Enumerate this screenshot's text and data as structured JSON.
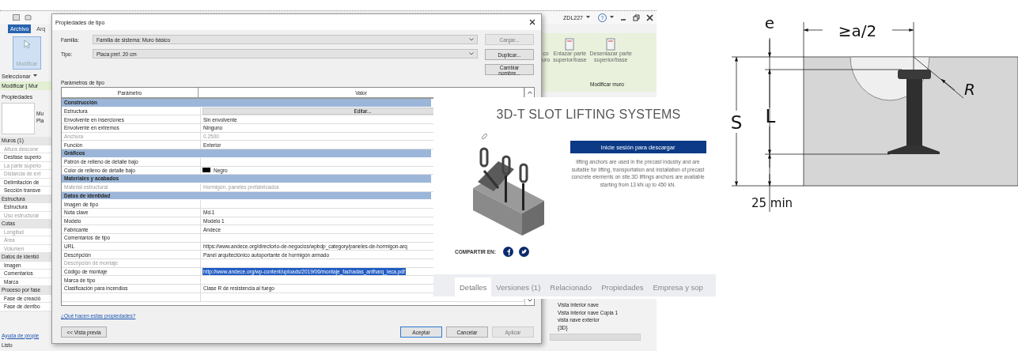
{
  "revit": {
    "user": "ZDL227",
    "help": "?",
    "tabs": [
      {
        "label": "Archivo",
        "selected": true
      },
      {
        "label": "Arq",
        "selected": false
      }
    ],
    "modify_tool": "Modificar",
    "select_menu": "Seleccionar",
    "context_bar": "Modificar | Mur",
    "properties": {
      "title": "Propiedades",
      "type_fragments": [
        "Mu",
        "Pla"
      ],
      "rows": [
        {
          "label": "Muros (1)",
          "kind": "header",
          "disabled": false
        },
        {
          "label": "Altura descone",
          "kind": "item",
          "disabled": true
        },
        {
          "label": "Desfase superio",
          "kind": "item",
          "disabled": false
        },
        {
          "label": "La parte superio",
          "kind": "item",
          "disabled": true
        },
        {
          "label": "Distancia de ext",
          "kind": "item",
          "disabled": true
        },
        {
          "label": "Delimitación de",
          "kind": "item",
          "disabled": false
        },
        {
          "label": "Sección transve",
          "kind": "item",
          "disabled": false
        },
        {
          "label": "Estructura",
          "kind": "header",
          "disabled": false
        },
        {
          "label": "Estructura",
          "kind": "item",
          "disabled": false
        },
        {
          "label": "Uso estructural",
          "kind": "item",
          "disabled": true
        },
        {
          "label": "Cotas",
          "kind": "header",
          "disabled": false
        },
        {
          "label": "Longitud",
          "kind": "item",
          "disabled": true
        },
        {
          "label": "Área",
          "kind": "item",
          "disabled": true
        },
        {
          "label": "Volumen",
          "kind": "item",
          "disabled": true
        },
        {
          "label": "Datos de identid",
          "kind": "header",
          "disabled": false
        },
        {
          "label": "Imagen",
          "kind": "item",
          "disabled": false
        },
        {
          "label": "Comentarios",
          "kind": "item",
          "disabled": false
        },
        {
          "label": "Marca",
          "kind": "item",
          "disabled": false
        },
        {
          "label": "Proceso por fase",
          "kind": "header",
          "disabled": false
        },
        {
          "label": "Fase de creació",
          "kind": "item",
          "disabled": false
        },
        {
          "label": "Fase de derribo",
          "kind": "item",
          "disabled": false
        }
      ],
      "help_link": "Ayuda de propie"
    },
    "ribbon_tools": [
      {
        "lines": [
          "co",
          "uro"
        ]
      },
      {
        "lines": [
          "Enlazar parte",
          "superior/base"
        ]
      },
      {
        "lines": [
          "Desenlazar parte",
          "superior/base"
        ]
      }
    ],
    "ribbon_panel": "Modificar muro",
    "browser_items": [
      "Vista interior nave",
      "Vista interior nave Copia 1",
      "vista nave exterior",
      "{3D}"
    ],
    "status": "Listo"
  },
  "dialog": {
    "title": "Propiedades de tipo",
    "family": {
      "label": "Familia:",
      "value": "Familia de sistema: Muro básico"
    },
    "type": {
      "label": "Tipo:",
      "value": "Placa pref. 20 cm"
    },
    "buttons": [
      {
        "label": "Cargar...",
        "disabled": true
      },
      {
        "label": "Duplicar...",
        "disabled": false
      },
      {
        "label": "Cambiar nombre...",
        "disabled": false
      }
    ],
    "section": "Parámetros de tipo",
    "columns": [
      "Parámetro",
      "Valor"
    ],
    "rows": [
      {
        "kind": "category",
        "label": "Construcción"
      },
      {
        "kind": "button",
        "label": "Estructura",
        "value": "Editar...",
        "disabled": false
      },
      {
        "kind": "text",
        "label": "Envolvente en inserciones",
        "value": "Sin envolvente",
        "disabled": false,
        "selected": false
      },
      {
        "kind": "text",
        "label": "Envolvente en extremos",
        "value": "Ninguno",
        "disabled": false,
        "selected": false
      },
      {
        "kind": "text",
        "label": "Anchura",
        "value": "0.2500",
        "disabled": true,
        "selected": false
      },
      {
        "kind": "text",
        "label": "Función",
        "value": "Exterior",
        "disabled": false,
        "selected": false
      },
      {
        "kind": "category",
        "label": "Gráficos"
      },
      {
        "kind": "text",
        "label": "Patrón de relleno de detalle bajo",
        "disabled": false
      },
      {
        "kind": "swatch",
        "label": "Color de relleno de detalle bajo",
        "value": "Negro",
        "color": "#000000",
        "disabled": false,
        "selected": false
      },
      {
        "kind": "category",
        "label": "Materiales y acabados"
      },
      {
        "kind": "text",
        "label": "Material estructural",
        "value": "Hormigón, paneles prefabricados",
        "disabled": true,
        "selected": false
      },
      {
        "kind": "category",
        "label": "Datos de identidad"
      },
      {
        "kind": "text",
        "label": "Imagen de tipo",
        "disabled": false
      },
      {
        "kind": "text",
        "label": "Nota clave",
        "value": "Md.1",
        "disabled": false,
        "selected": false
      },
      {
        "kind": "text",
        "label": "Modelo",
        "value": "Modelo 1",
        "disabled": false,
        "selected": false
      },
      {
        "kind": "text",
        "label": "Fabricante",
        "value": "Andece",
        "disabled": false,
        "selected": false
      },
      {
        "kind": "text",
        "label": "Comentarios de tipo",
        "disabled": false
      },
      {
        "kind": "text",
        "label": "URL",
        "value": "https://www.andece.org/directorio-de-negocios/wpbdp_category/paneles-de-hormigon-arq",
        "disabled": false,
        "selected": false
      },
      {
        "kind": "text",
        "label": "Descripción",
        "value": "Panel arquitectónico autoportante de hormigón armado",
        "disabled": false,
        "selected": false
      },
      {
        "kind": "text",
        "label": "Descripción de montaje",
        "disabled": true
      },
      {
        "kind": "text",
        "label": "Código de montaje",
        "value": "http://www.andece.org/wp-content/uploads/2019/06/montaje_fachadas_anfharq_ieca.pdf",
        "disabled": false,
        "selected": true
      },
      {
        "kind": "text",
        "label": "Marca de tipo",
        "disabled": false
      },
      {
        "kind": "text",
        "label": "Clasificación para incendios",
        "value": "Clase R de resistencia al fuego",
        "disabled": false,
        "selected": false
      }
    ],
    "help_link": "¿Qué hacen estas propiedades?",
    "preview": "<< Vista previa",
    "actions": [
      {
        "label": "Aceptar",
        "default": true,
        "disabled": false
      },
      {
        "label": "Cancelar",
        "default": false,
        "disabled": false
      },
      {
        "label": "Aplicar",
        "default": false,
        "disabled": true
      }
    ]
  },
  "web": {
    "title": "3D-T SLOT LIFTING SYSTEMS",
    "download": "Inicie sesión para descargar",
    "description": "lifting anchors are used in the precast industry and are suitable for lifting, transportation and installation of precast concrete elements on site.3D liftings anchors are available starting from 13 kN up to 450 kN.",
    "share": "COMPARTIR EN:",
    "tabs": [
      {
        "label": "Detalles",
        "selected": true
      },
      {
        "label": "Versiones (1)",
        "selected": false
      },
      {
        "label": "Relacionado",
        "selected": false
      },
      {
        "label": "Propiedades",
        "selected": false
      },
      {
        "label": "Empresa y sop",
        "selected": false
      }
    ]
  },
  "diagram": {
    "edge": "e",
    "spacing": "≥a/2",
    "depth": "S",
    "length": "L",
    "radius": "R",
    "cover": "25 min"
  }
}
